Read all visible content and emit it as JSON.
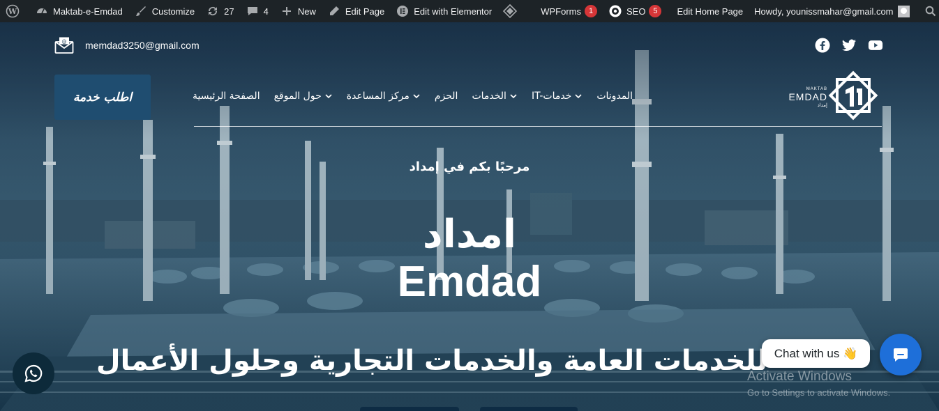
{
  "adminbar": {
    "items": [
      {
        "icon": "wordpress-icon",
        "label": ""
      },
      {
        "icon": "dashboard-icon",
        "label": "Maktab-e-Emdad"
      },
      {
        "icon": "brush-icon",
        "label": "Customize"
      },
      {
        "icon": "updates-icon",
        "label": "27"
      },
      {
        "icon": "comments-icon",
        "label": "4"
      },
      {
        "icon": "plus-icon",
        "label": "New"
      },
      {
        "icon": "pencil-icon",
        "label": "Edit Page"
      },
      {
        "icon": "elementor-icon",
        "label": "Edit with Elementor"
      },
      {
        "icon": "diamond-icon",
        "label": ""
      },
      {
        "label": "WPForms",
        "badge": "1"
      },
      {
        "icon": "seo-gear-icon",
        "label": "SEO",
        "badge": "5"
      },
      {
        "label": "Edit Home Page"
      }
    ],
    "howdy": "Howdy, younissmahar@gmail.com"
  },
  "topbar": {
    "email": "memdad3250@gmail.com",
    "socials": [
      "facebook-icon",
      "twitter-icon",
      "youtube-icon"
    ]
  },
  "nav": {
    "cta_label": "اطلب خدمة",
    "menu": [
      {
        "label": "الصفحة الرئيسية",
        "dropdown": false
      },
      {
        "label": "حول الموقع",
        "dropdown": true
      },
      {
        "label": "مركز المساعدة",
        "dropdown": true
      },
      {
        "label": "الحزم",
        "dropdown": false
      },
      {
        "label": "الخدمات",
        "dropdown": true
      },
      {
        "label": "IT-خدمات",
        "dropdown": true
      },
      {
        "label": "المدونات",
        "dropdown": false
      }
    ],
    "logo": {
      "small": "MAKTAB",
      "big": "EMDAD",
      "ar": "إمداد"
    }
  },
  "hero": {
    "welcome": "مرحبًا بكم في إمداد",
    "title_ar": "امداد",
    "title_en": "Emdad",
    "tagline": "للخدمات العامة والخدمات التجارية وحلول الأعمال"
  },
  "widgets": {
    "chat_label": "Chat with us 👋",
    "activate_title": "Activate Windows",
    "activate_sub": "Go to Settings to activate Windows."
  },
  "colors": {
    "adminbar": "#1d2327",
    "badge": "#d63638",
    "cta": "#1f4d70",
    "chat": "#1e6fd9"
  }
}
